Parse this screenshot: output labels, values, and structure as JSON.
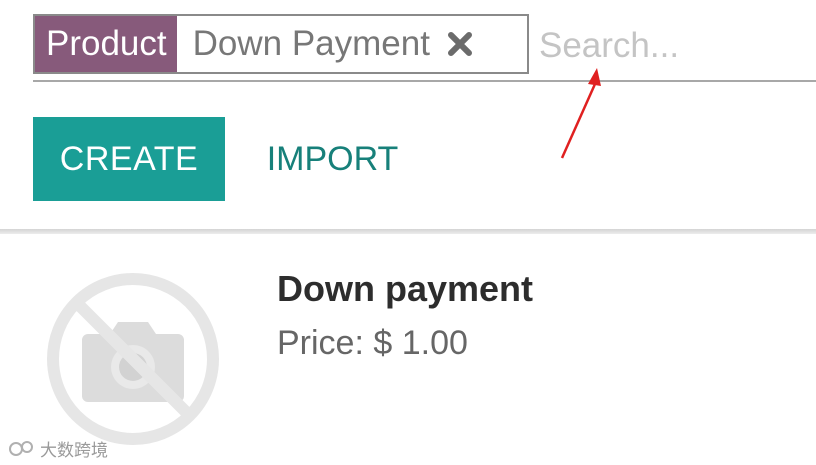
{
  "search": {
    "facet_label": "Product",
    "facet_value": "Down Payment",
    "placeholder": "Search..."
  },
  "buttons": {
    "create_label": "CREATE",
    "import_label": "IMPORT"
  },
  "product": {
    "name": "Down payment",
    "price": "Price: $ 1.00"
  },
  "watermark": {
    "text": "大数跨境"
  },
  "colors": {
    "facet_purple": "#875a7b",
    "primary_teal": "#1a9e96",
    "link_teal": "#17807a",
    "annotation_arrow": "#e02020"
  },
  "icons": {
    "facet_remove": "close-icon",
    "product_image": "no-image-camera-icon",
    "annotation": "red-arrow-annotation"
  }
}
